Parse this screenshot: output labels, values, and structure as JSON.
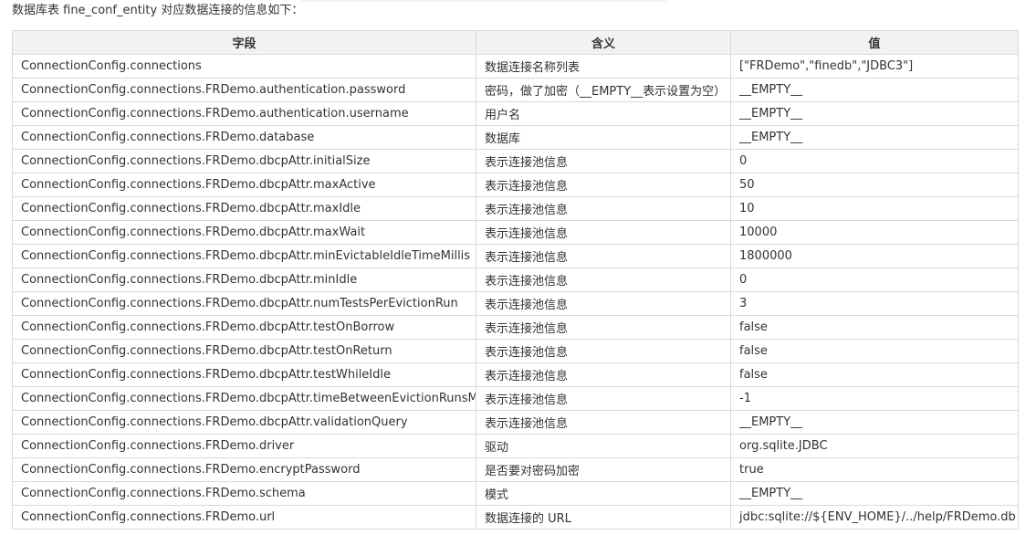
{
  "intro_text": "数据库表 fine_conf_entity 对应数据连接的信息如下：",
  "table": {
    "headers": [
      "字段",
      "含义",
      "值"
    ],
    "rows": [
      [
        "ConnectionConfig.connections",
        " 数据连接名称列表",
        "[\"FRDemo\",\"finedb\",\"JDBC3\"]"
      ],
      [
        "ConnectionConfig.connections.FRDemo.authentication.password",
        "密码，做了加密（__EMPTY__表示设置为空）",
        "__EMPTY__"
      ],
      [
        "ConnectionConfig.connections.FRDemo.authentication.username",
        "用户名",
        "__EMPTY__"
      ],
      [
        "ConnectionConfig.connections.FRDemo.database",
        "数据库",
        "__EMPTY__"
      ],
      [
        "ConnectionConfig.connections.FRDemo.dbcpAttr.initialSize",
        "表示连接池信息",
        "0"
      ],
      [
        "ConnectionConfig.connections.FRDemo.dbcpAttr.maxActive",
        "表示连接池信息",
        "50"
      ],
      [
        "ConnectionConfig.connections.FRDemo.dbcpAttr.maxIdle",
        "表示连接池信息",
        "10"
      ],
      [
        "ConnectionConfig.connections.FRDemo.dbcpAttr.maxWait",
        "表示连接池信息",
        "10000"
      ],
      [
        "ConnectionConfig.connections.FRDemo.dbcpAttr.minEvictableIdleTimeMillis",
        "表示连接池信息",
        "1800000"
      ],
      [
        "ConnectionConfig.connections.FRDemo.dbcpAttr.minIdle",
        "表示连接池信息",
        "0"
      ],
      [
        "ConnectionConfig.connections.FRDemo.dbcpAttr.numTestsPerEvictionRun",
        "表示连接池信息",
        "3"
      ],
      [
        "ConnectionConfig.connections.FRDemo.dbcpAttr.testOnBorrow",
        "表示连接池信息",
        "false"
      ],
      [
        "ConnectionConfig.connections.FRDemo.dbcpAttr.testOnReturn",
        "表示连接池信息",
        "false"
      ],
      [
        "ConnectionConfig.connections.FRDemo.dbcpAttr.testWhileIdle",
        "表示连接池信息",
        "false"
      ],
      [
        "ConnectionConfig.connections.FRDemo.dbcpAttr.timeBetweenEvictionRunsMillis",
        "表示连接池信息",
        "-1"
      ],
      [
        "ConnectionConfig.connections.FRDemo.dbcpAttr.validationQuery",
        "表示连接池信息",
        "__EMPTY__"
      ],
      [
        "ConnectionConfig.connections.FRDemo.driver",
        "驱动",
        "org.sqlite.JDBC"
      ],
      [
        "ConnectionConfig.connections.FRDemo.encryptPassword",
        "是否要对密码加密",
        "true"
      ],
      [
        "ConnectionConfig.connections.FRDemo.schema",
        "模式",
        "__EMPTY__"
      ],
      [
        "ConnectionConfig.connections.FRDemo.url",
        "数据连接的 URL",
        "jdbc:sqlite://${ENV_HOME}/../help/FRDemo.db"
      ]
    ]
  }
}
